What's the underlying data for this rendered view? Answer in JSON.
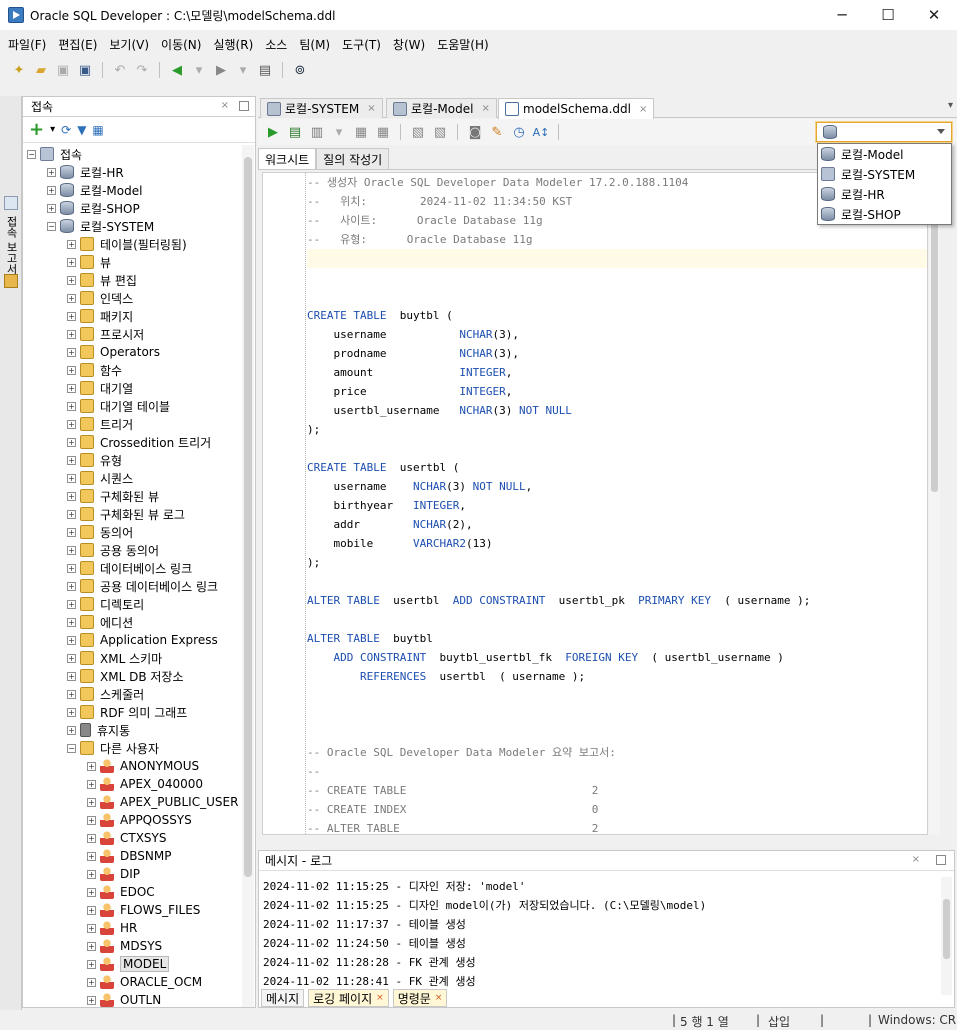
{
  "window": {
    "title": "Oracle SQL Developer : C:\\모델링\\modelSchema.ddl",
    "min": "─",
    "max": "☐",
    "close": "✕"
  },
  "menu": [
    "파일(F)",
    "편집(E)",
    "보기(V)",
    "이동(N)",
    "실행(R)",
    "소스",
    "팀(M)",
    "도구(T)",
    "창(W)",
    "도움말(H)"
  ],
  "side_tab": "접속 보고서",
  "connections": {
    "title": "접속",
    "close": "×",
    "items": [
      {
        "t": "접속",
        "lvl": 0,
        "exp": "−",
        "icon": "conn"
      },
      {
        "t": "로컬-HR",
        "lvl": 1,
        "exp": "+",
        "icon": "db"
      },
      {
        "t": "로컬-Model",
        "lvl": 1,
        "exp": "+",
        "icon": "db"
      },
      {
        "t": "로컬-SHOP",
        "lvl": 1,
        "exp": "+",
        "icon": "db"
      },
      {
        "t": "로컬-SYSTEM",
        "lvl": 1,
        "exp": "−",
        "icon": "db"
      },
      {
        "t": "테이블(필터링됨)",
        "lvl": 2,
        "exp": "+",
        "icon": "fold"
      },
      {
        "t": "뷰",
        "lvl": 2,
        "exp": "+",
        "icon": "fold"
      },
      {
        "t": "뷰 편집",
        "lvl": 2,
        "exp": "+",
        "icon": "fold"
      },
      {
        "t": "인덱스",
        "lvl": 2,
        "exp": "+",
        "icon": "fold"
      },
      {
        "t": "패키지",
        "lvl": 2,
        "exp": "+",
        "icon": "fold"
      },
      {
        "t": "프로시저",
        "lvl": 2,
        "exp": "+",
        "icon": "fold"
      },
      {
        "t": "Operators",
        "lvl": 2,
        "exp": "+",
        "icon": "fold"
      },
      {
        "t": "함수",
        "lvl": 2,
        "exp": "+",
        "icon": "fold"
      },
      {
        "t": "대기열",
        "lvl": 2,
        "exp": "+",
        "icon": "fold"
      },
      {
        "t": "대기열 테이블",
        "lvl": 2,
        "exp": "+",
        "icon": "fold"
      },
      {
        "t": "트리거",
        "lvl": 2,
        "exp": "+",
        "icon": "fold"
      },
      {
        "t": "Crossedition 트리거",
        "lvl": 2,
        "exp": "+",
        "icon": "fold"
      },
      {
        "t": "유형",
        "lvl": 2,
        "exp": "+",
        "icon": "fold"
      },
      {
        "t": "시퀀스",
        "lvl": 2,
        "exp": "+",
        "icon": "fold"
      },
      {
        "t": "구체화된 뷰",
        "lvl": 2,
        "exp": "+",
        "icon": "fold"
      },
      {
        "t": "구체화된 뷰 로그",
        "lvl": 2,
        "exp": "+",
        "icon": "fold"
      },
      {
        "t": "동의어",
        "lvl": 2,
        "exp": "+",
        "icon": "fold"
      },
      {
        "t": "공용 동의어",
        "lvl": 2,
        "exp": "+",
        "icon": "fold"
      },
      {
        "t": "데이터베이스 링크",
        "lvl": 2,
        "exp": "+",
        "icon": "fold"
      },
      {
        "t": "공용 데이터베이스 링크",
        "lvl": 2,
        "exp": "+",
        "icon": "fold"
      },
      {
        "t": "디렉토리",
        "lvl": 2,
        "exp": "+",
        "icon": "fold"
      },
      {
        "t": "에디션",
        "lvl": 2,
        "exp": "+",
        "icon": "fold"
      },
      {
        "t": "Application Express",
        "lvl": 2,
        "exp": "+",
        "icon": "fold"
      },
      {
        "t": "XML 스키마",
        "lvl": 2,
        "exp": "+",
        "icon": "fold"
      },
      {
        "t": "XML DB 저장소",
        "lvl": 2,
        "exp": "+",
        "icon": "fold"
      },
      {
        "t": "스케줄러",
        "lvl": 2,
        "exp": "+",
        "icon": "fold"
      },
      {
        "t": "RDF 의미 그래프",
        "lvl": 2,
        "exp": "+",
        "icon": "fold"
      },
      {
        "t": "휴지통",
        "lvl": 2,
        "exp": "+",
        "icon": "trash"
      },
      {
        "t": "다른 사용자",
        "lvl": 2,
        "exp": "−",
        "icon": "fold"
      },
      {
        "t": "ANONYMOUS",
        "lvl": 3,
        "exp": "+",
        "icon": "user"
      },
      {
        "t": "APEX_040000",
        "lvl": 3,
        "exp": "+",
        "icon": "user"
      },
      {
        "t": "APEX_PUBLIC_USER",
        "lvl": 3,
        "exp": "+",
        "icon": "user"
      },
      {
        "t": "APPQOSSYS",
        "lvl": 3,
        "exp": "+",
        "icon": "user"
      },
      {
        "t": "CTXSYS",
        "lvl": 3,
        "exp": "+",
        "icon": "user"
      },
      {
        "t": "DBSNMP",
        "lvl": 3,
        "exp": "+",
        "icon": "user"
      },
      {
        "t": "DIP",
        "lvl": 3,
        "exp": "+",
        "icon": "user"
      },
      {
        "t": "EDOC",
        "lvl": 3,
        "exp": "+",
        "icon": "user"
      },
      {
        "t": "FLOWS_FILES",
        "lvl": 3,
        "exp": "+",
        "icon": "user"
      },
      {
        "t": "HR",
        "lvl": 3,
        "exp": "+",
        "icon": "user"
      },
      {
        "t": "MDSYS",
        "lvl": 3,
        "exp": "+",
        "icon": "user"
      },
      {
        "t": "MODEL",
        "lvl": 3,
        "exp": "+",
        "icon": "user",
        "selected": true
      },
      {
        "t": "ORACLE_OCM",
        "lvl": 3,
        "exp": "+",
        "icon": "user"
      },
      {
        "t": "OUTLN",
        "lvl": 3,
        "exp": "+",
        "icon": "user"
      }
    ]
  },
  "editor_tabs": [
    {
      "label": "로컬-SYSTEM",
      "close": "×",
      "icon": "db"
    },
    {
      "label": "로컬-Model",
      "close": "×",
      "icon": "db"
    },
    {
      "label": "modelSchema.ddl",
      "close": "×",
      "icon": "doc",
      "active": true
    }
  ],
  "connection_dropdown": {
    "options": [
      "로컬-Model",
      "로컬-SYSTEM",
      "로컬-HR",
      "로컬-SHOP"
    ]
  },
  "subtabs": [
    "워크시트",
    "질의 작성기"
  ],
  "code_lines": [
    [
      [
        "cm",
        "-- 생성자 Oracle SQL Developer Data Modeler 17.2.0.188.1104"
      ]
    ],
    [
      [
        "cm",
        "--   위치:        2024-11-02 11:34:50 KST"
      ]
    ],
    [
      [
        "cm",
        "--   사이트:      Oracle Database 11g"
      ]
    ],
    [
      [
        "cm",
        "--   유형:      Oracle Database 11g"
      ]
    ],
    [],
    [],
    [],
    [
      [
        "kw",
        "CREATE TABLE"
      ],
      [
        "",
        "  buytbl ("
      ]
    ],
    [
      [
        "",
        "    username           "
      ],
      [
        "kw",
        "NCHAR"
      ],
      [
        "",
        "(3),"
      ]
    ],
    [
      [
        "",
        "    prodname           "
      ],
      [
        "kw",
        "NCHAR"
      ],
      [
        "",
        "(3),"
      ]
    ],
    [
      [
        "",
        "    amount             "
      ],
      [
        "kw",
        "INTEGER"
      ],
      [
        "",
        ","
      ]
    ],
    [
      [
        "",
        "    price              "
      ],
      [
        "kw",
        "INTEGER"
      ],
      [
        "",
        ","
      ]
    ],
    [
      [
        "",
        "    usertbl_username   "
      ],
      [
        "kw",
        "NCHAR"
      ],
      [
        "",
        "(3) "
      ],
      [
        "kw",
        "NOT NULL"
      ]
    ],
    [
      [
        "",
        ");"
      ]
    ],
    [],
    [
      [
        "kw",
        "CREATE TABLE"
      ],
      [
        "",
        "  usertbl ("
      ]
    ],
    [
      [
        "",
        "    username    "
      ],
      [
        "kw",
        "NCHAR"
      ],
      [
        "",
        "(3) "
      ],
      [
        "kw",
        "NOT NULL"
      ],
      [
        "",
        ","
      ]
    ],
    [
      [
        "",
        "    birthyear   "
      ],
      [
        "kw",
        "INTEGER"
      ],
      [
        "",
        ","
      ]
    ],
    [
      [
        "",
        "    addr        "
      ],
      [
        "kw",
        "NCHAR"
      ],
      [
        "",
        "(2),"
      ]
    ],
    [
      [
        "",
        "    mobile      "
      ],
      [
        "kw",
        "VARCHAR2"
      ],
      [
        "",
        "(13)"
      ]
    ],
    [
      [
        "",
        ");"
      ]
    ],
    [],
    [
      [
        "kw",
        "ALTER TABLE"
      ],
      [
        "",
        "  usertbl  "
      ],
      [
        "kw",
        "ADD CONSTRAINT"
      ],
      [
        "",
        "  usertbl_pk  "
      ],
      [
        "kw",
        "PRIMARY KEY"
      ],
      [
        "",
        "  ( username );"
      ]
    ],
    [],
    [
      [
        "kw",
        "ALTER TABLE"
      ],
      [
        "",
        "  buytbl"
      ]
    ],
    [
      [
        "",
        "    "
      ],
      [
        "kw",
        "ADD CONSTRAINT"
      ],
      [
        "",
        "  buytbl_usertbl_fk  "
      ],
      [
        "kw",
        "FOREIGN KEY"
      ],
      [
        "",
        "  ( usertbl_username )"
      ]
    ],
    [
      [
        "",
        "        "
      ],
      [
        "kw",
        "REFERENCES"
      ],
      [
        "",
        "  usertbl  ( username );"
      ]
    ],
    [],
    [],
    [],
    [
      [
        "cm",
        "-- Oracle SQL Developer Data Modeler 요약 보고서:"
      ]
    ],
    [
      [
        "cm",
        "--"
      ]
    ],
    [
      [
        "cm",
        "-- CREATE TABLE                            2"
      ]
    ],
    [
      [
        "cm",
        "-- CREATE INDEX                            0"
      ]
    ],
    [
      [
        "cm",
        "-- ALTER TABLE                             2"
      ]
    ]
  ],
  "messages": {
    "title": "메시지 - 로그",
    "close": "×",
    "lines": [
      "2024-11-02 11:15:25 - 디자인 저장: 'model'",
      "2024-11-02 11:15:25 - 디자인 model이(가) 저장되었습니다. (C:\\모델링\\model)",
      "2024-11-02 11:17:37 - 테이블 생성",
      "2024-11-02 11:24:50 - 테이블 생성",
      "2024-11-02 11:28:28 - FK 관계 생성",
      "2024-11-02 11:28:41 - FK 관계 생성"
    ],
    "tabs": [
      "메시지",
      "로깅 페이지",
      "명령문"
    ],
    "tab_close": "×"
  },
  "status": {
    "pos": "5 행 1 열",
    "mode": "삽입",
    "eol": "Windows: CR"
  }
}
